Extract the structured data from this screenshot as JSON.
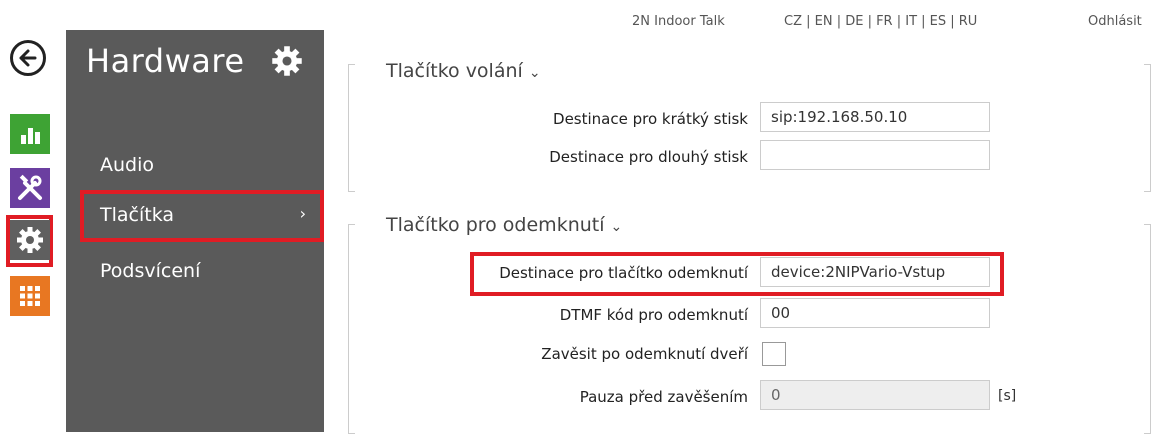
{
  "header": {
    "product": "2N Indoor Talk",
    "languages": "CZ | EN | DE | FR | IT | ES | RU",
    "logout": "Odhlásit"
  },
  "nav_strip": {
    "back_icon": "arrow-left-icon",
    "items": [
      {
        "name": "status",
        "icon": "chart-icon",
        "color": "#3ea334"
      },
      {
        "name": "services",
        "icon": "tools-icon",
        "color": "#6b3fa0"
      },
      {
        "name": "hardware",
        "icon": "gear-icon",
        "color": "#5f5f5f",
        "active": true
      },
      {
        "name": "system",
        "icon": "grid-icon",
        "color": "#e87722"
      }
    ]
  },
  "sidebar": {
    "title": "Hardware",
    "items": [
      {
        "label": "Audio"
      },
      {
        "label": "Tlačítka",
        "chevron": "›"
      },
      {
        "label": "Podsvícení"
      }
    ]
  },
  "call_button": {
    "title": "Tlačítko volání",
    "caret": "⌄",
    "short_press_label": "Destinace pro krátký stisk",
    "short_press_value": "sip:192.168.50.10",
    "long_press_label": "Destinace pro dlouhý stisk",
    "long_press_value": ""
  },
  "unlock_button": {
    "title": "Tlačítko pro odemknutí",
    "caret": "⌄",
    "destination_label": "Destinace pro tlačítko odemknutí",
    "destination_value": "device:2NIPVario-Vstup",
    "dtmf_label": "DTMF kód pro odemknutí",
    "dtmf_value": "00",
    "hangup_label": "Zavěsit po odemknutí dveří",
    "pause_label": "Pauza před zavěšením",
    "pause_value": "0",
    "pause_unit": "[s]"
  },
  "accent_color": "#e01c24"
}
